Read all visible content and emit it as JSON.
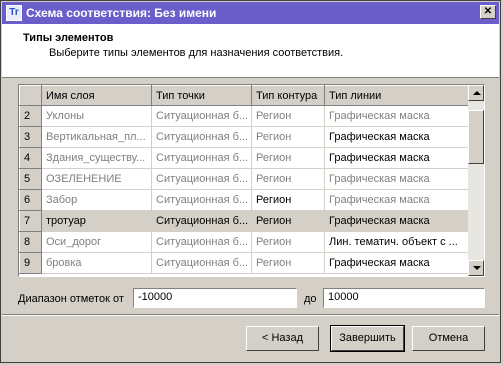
{
  "window": {
    "icon_text": "Tr",
    "title": "Схема соответствия: Без имени",
    "close_glyph": "✕"
  },
  "header": {
    "title": "Типы элементов",
    "subtitle": "Выберите типы элементов для назначения соответствия."
  },
  "grid": {
    "columns": [
      "Имя слоя",
      "Тип точки",
      "Тип контура",
      "Тип линии"
    ],
    "rows": [
      {
        "num": "2",
        "layer": "Уклоны",
        "point": "Ситуационная б...",
        "contour": "Регион",
        "line": "Графическая маска",
        "gray": [
          true,
          true,
          true,
          true
        ]
      },
      {
        "num": "3",
        "layer": "Вертикальная_пл...",
        "point": "Ситуационная б...",
        "contour": "Регион",
        "line": "Графическая маска",
        "gray": [
          true,
          true,
          true,
          false
        ]
      },
      {
        "num": "4",
        "layer": "Здания_существу...",
        "point": "Ситуационная б...",
        "contour": "Регион",
        "line": "Графическая маска",
        "gray": [
          true,
          true,
          true,
          false
        ]
      },
      {
        "num": "5",
        "layer": "ОЗЕЛЕНЕНИЕ",
        "point": "Ситуационная б...",
        "contour": "Регион",
        "line": "Графическая маска",
        "gray": [
          true,
          true,
          true,
          true
        ]
      },
      {
        "num": "6",
        "layer": "Забор",
        "point": "Ситуационная б...",
        "contour": "Регион",
        "line": "Графическая маска",
        "gray": [
          true,
          true,
          false,
          true
        ]
      },
      {
        "num": "7",
        "layer": "тротуар",
        "point": "Ситуационная б...",
        "contour": "Регион",
        "line": "Графическая маска",
        "gray": [
          false,
          false,
          false,
          false
        ],
        "selected": true
      },
      {
        "num": "8",
        "layer": "Оси_дорог",
        "point": "Ситуационная б...",
        "contour": "Регион",
        "line": "Лин. тематич. объект с ...",
        "gray": [
          true,
          true,
          true,
          false
        ]
      },
      {
        "num": "9",
        "layer": "бровка",
        "point": "Ситуационная б...",
        "contour": "Регион",
        "line": "Графическая маска",
        "gray": [
          true,
          true,
          true,
          false
        ]
      }
    ],
    "scrollbar_position": 0.09
  },
  "range": {
    "label": "Диапазон отметок от",
    "from_value": "-10000",
    "to_label": "до",
    "to_value": "10000"
  },
  "buttons": {
    "back": "< Назад",
    "finish": "Завершить",
    "cancel": "Отмена"
  }
}
